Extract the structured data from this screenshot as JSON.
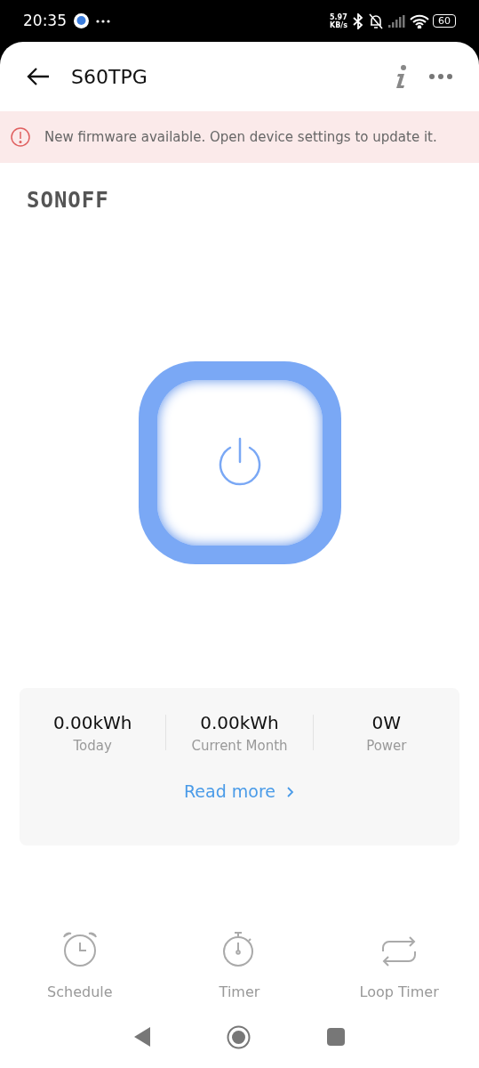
{
  "status_bar": {
    "time": "20:35",
    "net_speed": "5.97 KB/s",
    "battery": "60"
  },
  "header": {
    "title": "S60TPG"
  },
  "banner": {
    "text": "New firmware available. Open device settings to update it."
  },
  "brand": "SONOFF",
  "stats": [
    {
      "value": "0.00kWh",
      "label": "Today"
    },
    {
      "value": "0.00kWh",
      "label": "Current Month"
    },
    {
      "value": "0W",
      "label": "Power"
    }
  ],
  "read_more": "Read more",
  "actions": [
    {
      "kind": "alarm",
      "label": "Schedule"
    },
    {
      "kind": "stopwatch",
      "label": "Timer"
    },
    {
      "kind": "loop",
      "label": "Loop Timer"
    }
  ]
}
